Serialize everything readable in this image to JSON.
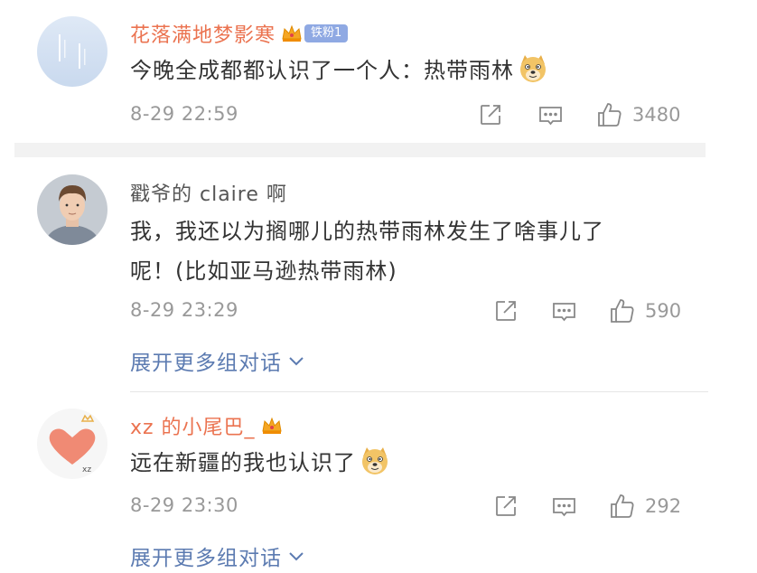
{
  "comments": [
    {
      "username": "花落满地梦影寒",
      "fan_badge": "铁粉1",
      "text": "今晚全成都都认识了一个人：热带雨林",
      "time": "8-29 22:59",
      "likes": "3480",
      "emoji": "doge-emoji"
    },
    {
      "username": "戳爷的 claire 啊",
      "text_line1": "我，我还以为搁哪儿的热带雨林发生了啥事儿了",
      "text_line2": "呢！(比如亚马逊热带雨林)",
      "time": "8-29 23:29",
      "likes": "590",
      "expand_label": "展开更多组对话"
    },
    {
      "username": "xz 的小尾巴_",
      "text": "远在新疆的我也认识了",
      "time": "8-29 23:30",
      "likes": "292",
      "expand_label": "展开更多组对话",
      "emoji": "doge-emoji"
    }
  ],
  "colors": {
    "username_accent": "#eb7350",
    "link_blue": "#5c7bb1",
    "meta_gray": "#999999",
    "badge_blue": "#8fa9e3"
  },
  "icons": [
    "share-icon",
    "comment-icon",
    "like-icon",
    "crown-icon",
    "chevron-down-icon",
    "doge-emoji"
  ]
}
